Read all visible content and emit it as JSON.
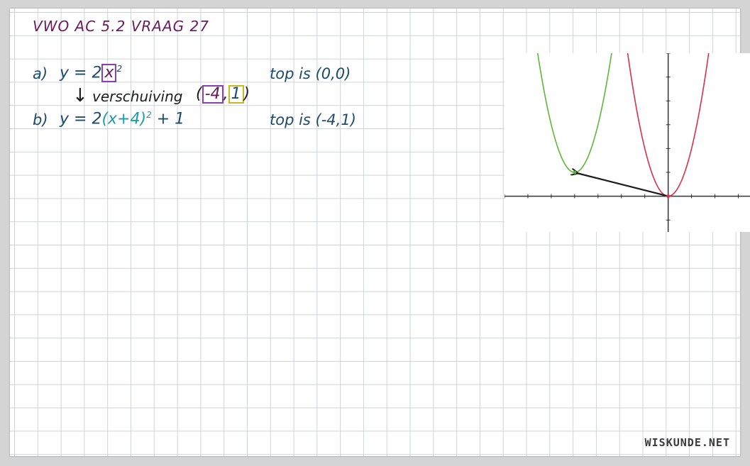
{
  "title": "VWO AC 5.2 VRAAG 27",
  "part_a": {
    "label": "a)",
    "formula_prefix": "y = 2",
    "formula_var": "x",
    "formula_exp": "2",
    "top_text": "top is (0,0)"
  },
  "shift": {
    "arrow": "↓",
    "text": "verschuiving",
    "open": "(",
    "dx": "-4",
    "comma": ",",
    "dy": "1",
    "close": ")"
  },
  "part_b": {
    "label": "b)",
    "formula_prefix": "y = 2",
    "formula_inner": "(x+4)",
    "formula_exp": "2",
    "formula_suffix": " + 1",
    "top_text": "top is (-4,1)"
  },
  "graph": {
    "original_curve": "y = 2x^2",
    "shifted_curve": "y = 2(x+4)^2 + 1",
    "original_vertex": [
      0,
      0
    ],
    "shifted_vertex": [
      -4,
      1
    ],
    "x_range": [
      -7,
      3.5
    ],
    "y_range": [
      -1.5,
      6
    ],
    "colors": {
      "original": "#d9304a",
      "shifted": "#5cb83a",
      "axis": "#333333",
      "arrow": "#1c1c1c"
    }
  },
  "watermark": "WISKUNDE.NET"
}
